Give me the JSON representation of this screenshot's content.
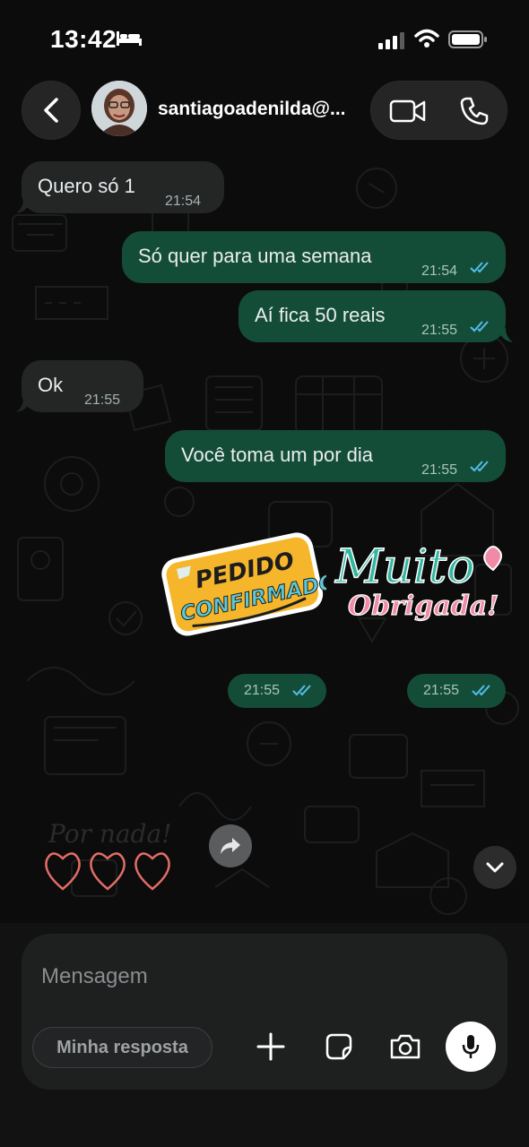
{
  "status_bar": {
    "time": "13:42"
  },
  "header": {
    "contact_name": "santiagoadenilda@..."
  },
  "messages": [
    {
      "direction": "in",
      "text": "Quero só 1",
      "time": "21:54"
    },
    {
      "direction": "out",
      "text": "Só quer para uma semana",
      "time": "21:54",
      "read": true
    },
    {
      "direction": "out",
      "text": "Aí fica 50 reais",
      "time": "21:55",
      "read": true
    },
    {
      "direction": "in",
      "text": "Ok",
      "time": "21:55"
    },
    {
      "direction": "out",
      "text": "Você toma um por dia",
      "time": "21:55",
      "read": true
    }
  ],
  "stickers": [
    {
      "line1": "PEDIDO",
      "line2": "CONFIRMADO",
      "time": "21:55"
    },
    {
      "line1": "Muito",
      "line2": "Obrigada!",
      "time": "21:55"
    },
    {
      "line1": "Por nada!"
    }
  ],
  "composer": {
    "placeholder": "Mensagem",
    "quick_reply": "Minha resposta"
  },
  "colors": {
    "outgoing_bubble": "#144d37",
    "incoming_bubble": "#242626",
    "read_ticks": "#53bdeb"
  }
}
